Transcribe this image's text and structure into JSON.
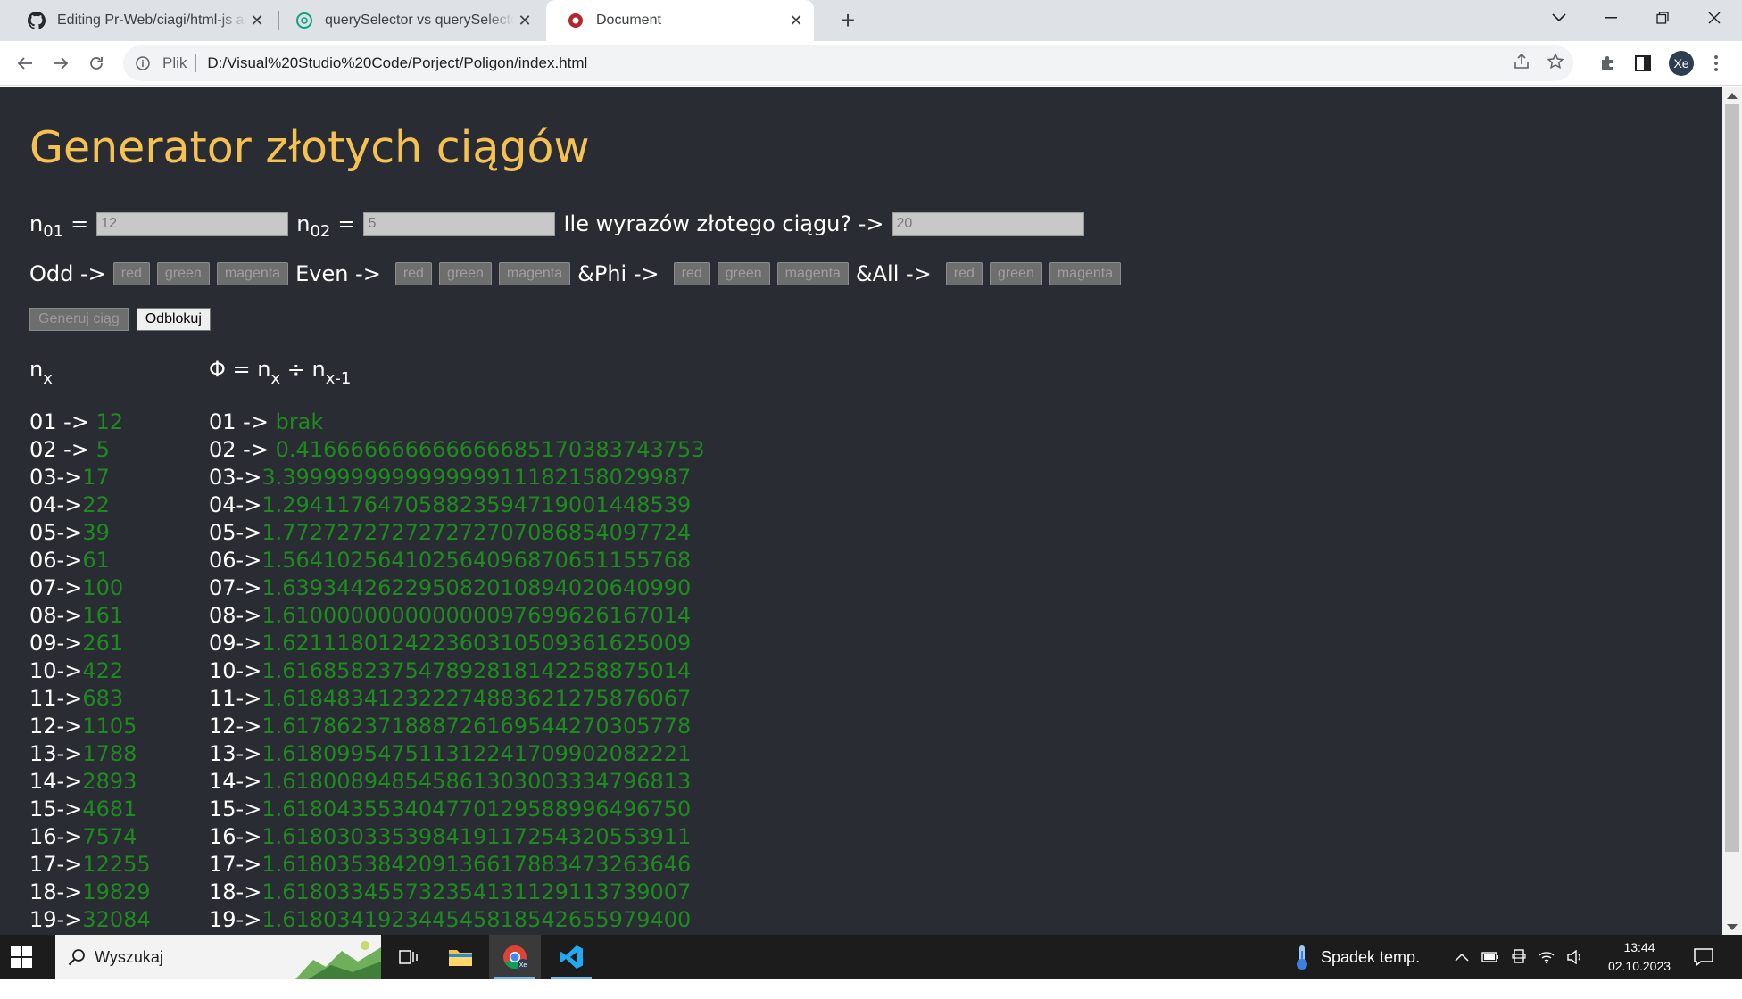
{
  "browser": {
    "tabs": [
      {
        "title": "Editing Pr-Web/ciagi/html-js at main",
        "icon": "github-icon"
      },
      {
        "title": "querySelector vs querySelectorAll",
        "icon": "chatgpt-icon"
      },
      {
        "title": "Document",
        "icon": "document-favicon"
      }
    ],
    "address": {
      "scheme": "Plik",
      "url": "D:/Visual%20Studio%20Code/Porject/Poligon/index.html"
    },
    "profile_initials": "Xe"
  },
  "page": {
    "title": "Generator złotych ciągów",
    "inputs": {
      "n01_label": "n",
      "n01_sub": "01",
      "n01_value": "12",
      "n02_label": "n",
      "n02_sub": "02",
      "n02_value": "5",
      "count_label": "Ile wyrazów złotego ciągu? ->",
      "count_value": "20",
      "equals": "="
    },
    "color_groups": [
      {
        "label": "Odd ->",
        "buttons": [
          "red",
          "green",
          "magenta"
        ]
      },
      {
        "label": "Even ->",
        "buttons": [
          "red",
          "green",
          "magenta"
        ]
      },
      {
        "label": "&Phi ->",
        "buttons": [
          "red",
          "green",
          "magenta"
        ]
      },
      {
        "label": "&All ->",
        "buttons": [
          "red",
          "green",
          "magenta"
        ]
      }
    ],
    "actions": {
      "generate": "Generuj ciąg",
      "unlock": "Odblokuj"
    },
    "col_n_header": {
      "base": "n",
      "sub": "x"
    },
    "col_phi_header": {
      "pre": "Φ = n",
      "sub1": "x",
      "mid": " ÷ n",
      "sub2": "x-1"
    },
    "sequence": [
      {
        "idx": "01 -> ",
        "value": "12"
      },
      {
        "idx": "02 -> ",
        "value": "5"
      },
      {
        "idx": "03->",
        "value": "17"
      },
      {
        "idx": "04->",
        "value": "22"
      },
      {
        "idx": "05->",
        "value": "39"
      },
      {
        "idx": "06->",
        "value": "61"
      },
      {
        "idx": "07->",
        "value": "100"
      },
      {
        "idx": "08->",
        "value": "161"
      },
      {
        "idx": "09->",
        "value": "261"
      },
      {
        "idx": "10->",
        "value": "422"
      },
      {
        "idx": "11->",
        "value": "683"
      },
      {
        "idx": "12->",
        "value": "1105"
      },
      {
        "idx": "13->",
        "value": "1788"
      },
      {
        "idx": "14->",
        "value": "2893"
      },
      {
        "idx": "15->",
        "value": "4681"
      },
      {
        "idx": "16->",
        "value": "7574"
      },
      {
        "idx": "17->",
        "value": "12255"
      },
      {
        "idx": "18->",
        "value": "19829"
      },
      {
        "idx": "19->",
        "value": "32084"
      }
    ],
    "ratios": [
      {
        "idx": "01 -> ",
        "value": "brak"
      },
      {
        "idx": "02 -> ",
        "value": "0.41666666666666668517038374375 3"
      },
      {
        "idx": "03->",
        "value": "3.39999999999999991118215802998 7"
      },
      {
        "idx": "04->",
        "value": "1.29411764705882359471900144853 9"
      },
      {
        "idx": "05->",
        "value": "1.77272727272727270708685409772 4"
      },
      {
        "idx": "06->",
        "value": "1.56410256410256409687065115576 8"
      },
      {
        "idx": "07->",
        "value": "1.63934426229508201089402064099 0"
      },
      {
        "idx": "08->",
        "value": "1.61000000000000009769962616701 4"
      },
      {
        "idx": "09->",
        "value": "1.62111801242236031050936162500 9"
      },
      {
        "idx": "10->",
        "value": "1.61685823754789281814225887501 4"
      },
      {
        "idx": "11->",
        "value": "1.61848341232227488362127587606 7"
      },
      {
        "idx": "12->",
        "value": "1.61786237188872616954427030577 8"
      },
      {
        "idx": "13->",
        "value": "1.61809954751131224170990208222 1"
      },
      {
        "idx": "14->",
        "value": "1.61800894854586130300333479681 3"
      },
      {
        "idx": "15->",
        "value": "1.61804355340477012958899649675 0"
      },
      {
        "idx": "16->",
        "value": "1.61803033539841911725432055391 1"
      },
      {
        "idx": "17->",
        "value": "1.61803538420913661788347326364 6"
      },
      {
        "idx": "18->",
        "value": "1.61803345573235413112911373900 7"
      },
      {
        "idx": "19->",
        "value": "1.61803419234454581854265597940 0"
      }
    ]
  },
  "taskbar": {
    "search_placeholder": "Wyszukaj",
    "weather": "Spadek temp.",
    "time": "13:44",
    "date": "02.10.2023"
  },
  "colors": {
    "page_bg": "#292c33",
    "title": "#f5c150",
    "value_green": "#1f8a1f"
  }
}
